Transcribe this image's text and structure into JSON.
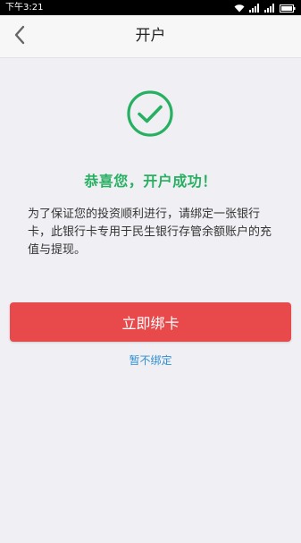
{
  "status_bar": {
    "time": "下午3:21"
  },
  "nav": {
    "title": "开户",
    "back_icon": "chevron-left-icon"
  },
  "success": {
    "icon": "check-circle-icon",
    "title": "恭喜您，开户成功！",
    "message": "为了保证您的投资顺利进行，请绑定一张银行卡，此银行卡专用于民生银行存管余额账户的充值与提现。"
  },
  "actions": {
    "bind_label": "立即绑卡",
    "skip_label": "暂不绑定"
  },
  "colors": {
    "accent_green": "#27b062",
    "button_red": "#e84a4c",
    "link_blue": "#2f8fd0"
  }
}
